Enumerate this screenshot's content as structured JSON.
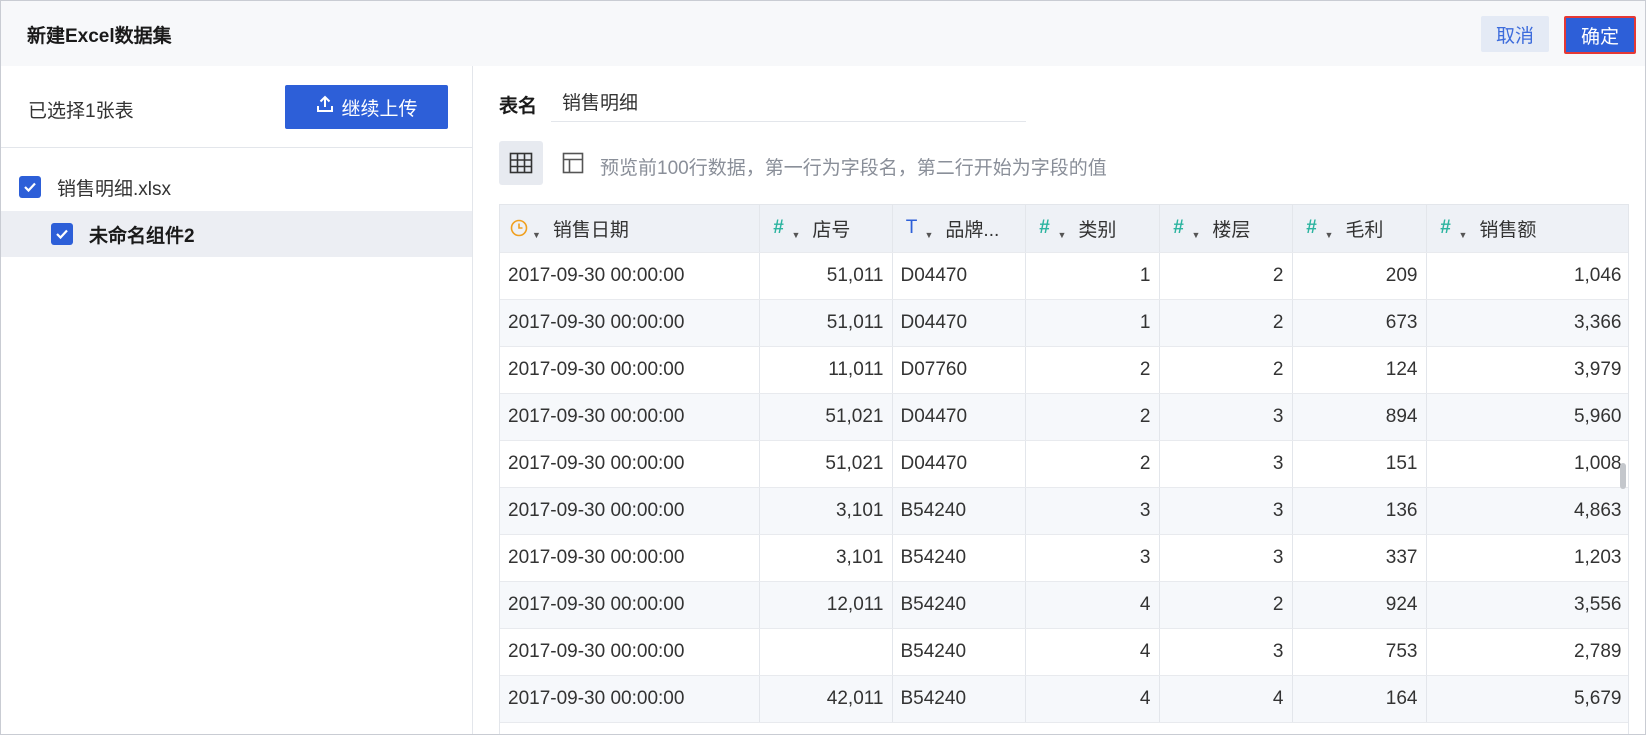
{
  "header": {
    "title": "新建Excel数据集",
    "cancel_label": "取消",
    "confirm_label": "确定"
  },
  "left": {
    "selected_count": "已选择1张表",
    "upload_label": "继续上传",
    "file_name": "销售明细.xlsx",
    "sheet_name": "未命名组件2"
  },
  "right": {
    "table_name_label": "表名",
    "table_name_value": "销售明细",
    "preview_hint": "预览前100行数据，第一行为字段名，第二行开始为字段的值"
  },
  "table": {
    "columns": [
      {
        "label": "销售日期",
        "type": "date-icon"
      },
      {
        "label": "店号",
        "type": "number-icon"
      },
      {
        "label": "品牌...",
        "type": "text-icon"
      },
      {
        "label": "类别",
        "type": "number-icon"
      },
      {
        "label": "楼层",
        "type": "number-icon"
      },
      {
        "label": "毛利",
        "type": "number-icon"
      },
      {
        "label": "销售额",
        "type": "number-icon"
      }
    ],
    "rows": [
      [
        "2017-09-30 00:00:00",
        "51,011",
        "D04470",
        "1",
        "2",
        "209",
        "1,046"
      ],
      [
        "2017-09-30 00:00:00",
        "51,011",
        "D04470",
        "1",
        "2",
        "673",
        "3,366"
      ],
      [
        "2017-09-30 00:00:00",
        "11,011",
        "D07760",
        "2",
        "2",
        "124",
        "3,979"
      ],
      [
        "2017-09-30 00:00:00",
        "51,021",
        "D04470",
        "2",
        "3",
        "894",
        "5,960"
      ],
      [
        "2017-09-30 00:00:00",
        "51,021",
        "D04470",
        "2",
        "3",
        "151",
        "1,008"
      ],
      [
        "2017-09-30 00:00:00",
        "3,101",
        "B54240",
        "3",
        "3",
        "136",
        "4,863"
      ],
      [
        "2017-09-30 00:00:00",
        "3,101",
        "B54240",
        "3",
        "3",
        "337",
        "1,203"
      ],
      [
        "2017-09-30 00:00:00",
        "12,011",
        "B54240",
        "4",
        "2",
        "924",
        "3,556"
      ],
      [
        "2017-09-30 00:00:00",
        "",
        "B54240",
        "4",
        "3",
        "753",
        "2,789"
      ],
      [
        "2017-09-30 00:00:00",
        "42,011",
        "B54240",
        "4",
        "4",
        "164",
        "5,679"
      ]
    ]
  },
  "colors": {
    "primary": "#2d5fd8",
    "number_icon": "#2cb4a0",
    "date_icon": "#f0a020",
    "highlight_border": "#e53935"
  }
}
